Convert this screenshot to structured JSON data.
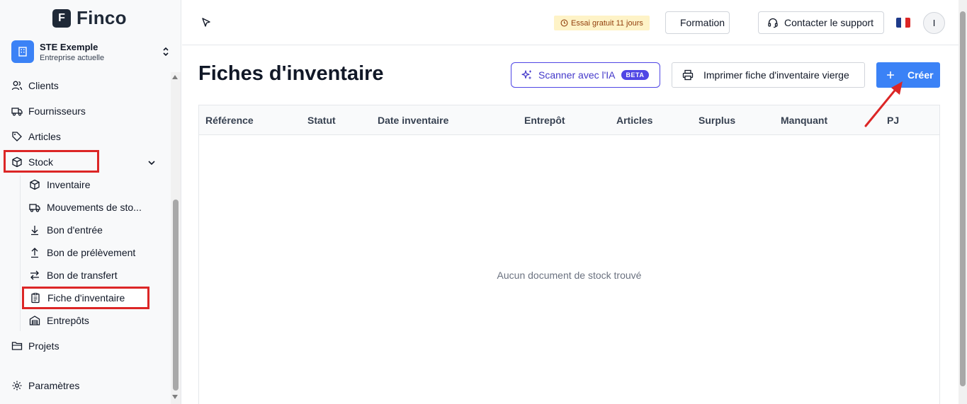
{
  "sidebar": {
    "logo_mark": "F",
    "logo_text": "Finco",
    "company_name": "STE Exemple",
    "company_sub": "Entreprise actuelle",
    "nav": {
      "clients": "Clients",
      "fournisseurs": "Fournisseurs",
      "articles": "Articles",
      "stock": "Stock",
      "projets": "Projets",
      "parametres": "Paramètres"
    },
    "stock_sub": {
      "inventaire": "Inventaire",
      "mouvements": "Mouvements de sto...",
      "bon_entree": "Bon d'entrée",
      "bon_prelevement": "Bon de prélèvement",
      "bon_transfert": "Bon de transfert",
      "fiche_inventaire": "Fiche d'inventaire",
      "entrepots": "Entrepôts"
    }
  },
  "topbar": {
    "trial": "Essai gratuit 11 jours",
    "formation": "Formation",
    "support": "Contacter le support",
    "avatar_initial": "I"
  },
  "main": {
    "title": "Fiches d'inventaire",
    "scan_ai": "Scanner avec l'IA",
    "beta": "BETA",
    "print_blank": "Imprimer fiche d'inventaire vierge",
    "create": "Créer"
  },
  "table": {
    "columns": [
      "Référence",
      "Statut",
      "Date inventaire",
      "Entrepôt",
      "Articles",
      "Surplus",
      "Manquant",
      "PJ"
    ],
    "empty_message": "Aucun document de stock trouvé"
  },
  "colors": {
    "accent": "#3b82f6",
    "ai_accent": "#4f46e5",
    "highlight": "#dc2626"
  }
}
